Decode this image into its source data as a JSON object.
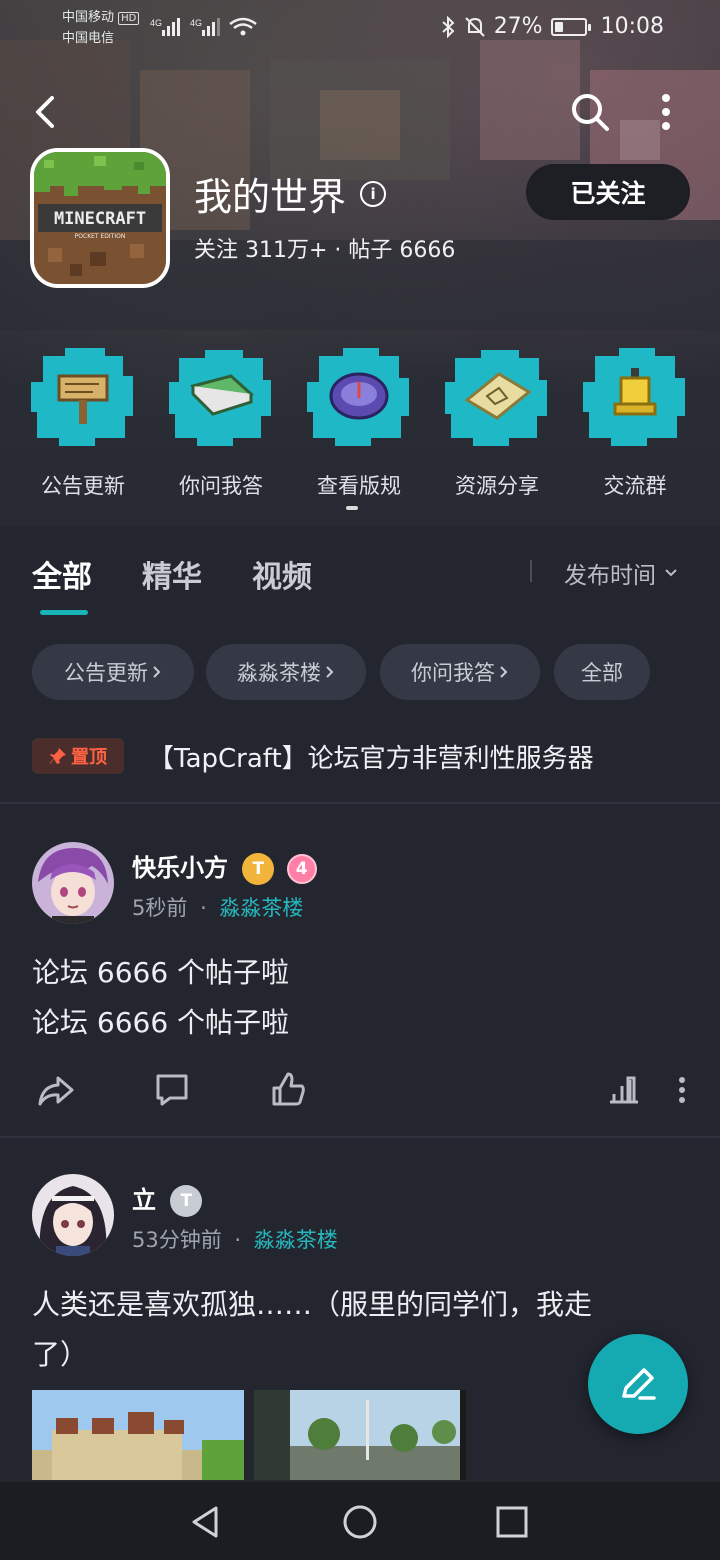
{
  "status_bar": {
    "carrier1": "中国移动",
    "carrier2": "中国电信",
    "hd": "HD",
    "net1": "4G",
    "net2": "4G",
    "battery_text": "27%",
    "battery_level": 0.27,
    "time": "10:08"
  },
  "header": {
    "app_title": "我的世界",
    "app_logo_text": "MINECRAFT",
    "app_logo_subtext": "POCKET EDITION",
    "info_icon": "i",
    "stats": "关注 311万+ · 帖子 6666",
    "follow_label": "已关注",
    "quick_links": [
      {
        "label": "公告更新",
        "icon": "signpost-icon"
      },
      {
        "label": "你问我答",
        "icon": "book-icon"
      },
      {
        "label": "查看版规",
        "icon": "compass-icon"
      },
      {
        "label": "资源分享",
        "icon": "map-icon"
      },
      {
        "label": "交流群",
        "icon": "bell-icon"
      }
    ]
  },
  "tabs": {
    "items": [
      "全部",
      "精华",
      "视频"
    ],
    "active_index": 0,
    "sort_label": "发布时间"
  },
  "chips": [
    "公告更新",
    "淼淼茶楼",
    "你问我答",
    "全部"
  ],
  "pinned": {
    "badge": "置顶",
    "title": "【TapCraft】论坛官方非营利性服务器"
  },
  "posts": [
    {
      "username": "快乐小方",
      "badge_t": "T",
      "level": "4",
      "time": "5秒前",
      "category": "淼淼茶楼",
      "lines": [
        "论坛 6666 个帖子啦",
        "论坛 6666 个帖子啦"
      ]
    },
    {
      "username": "立",
      "badge_t": "T",
      "time": "53分钟前",
      "category": "淼淼茶楼",
      "lines": [
        "人类还是喜欢孤独……（服里的同学们，我走",
        "了）"
      ]
    }
  ],
  "colors": {
    "accent": "#16b3b9",
    "pin": "#ff6242",
    "background": "#23262f",
    "chip": "#353946"
  }
}
